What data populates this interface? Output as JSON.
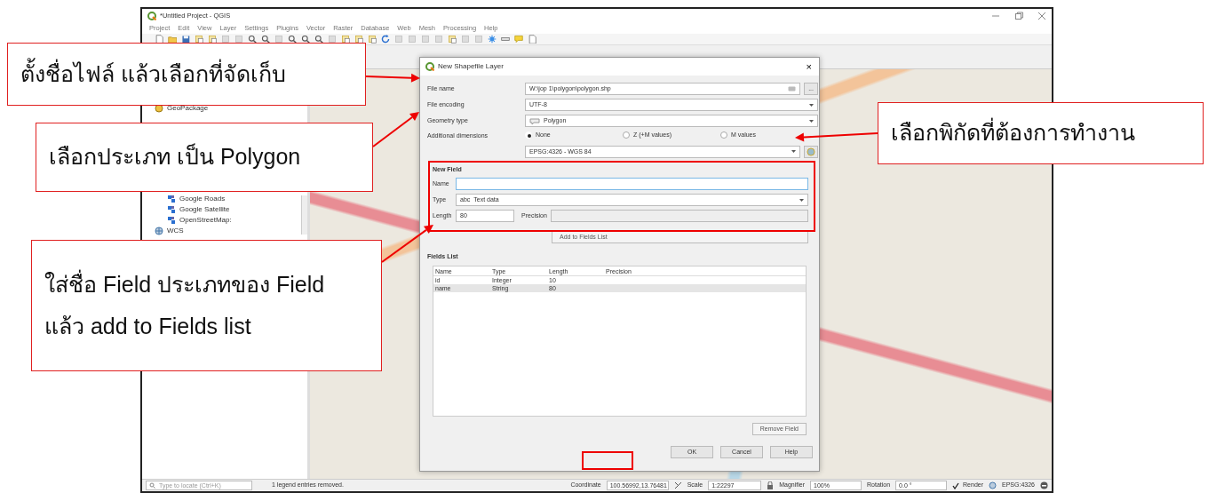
{
  "window": {
    "title": "*Untitled Project - QGIS"
  },
  "menu": [
    "Project",
    "Edit",
    "View",
    "Layer",
    "Settings",
    "Plugins",
    "Vector",
    "Raster",
    "Database",
    "Web",
    "Mesh",
    "Processing",
    "Help"
  ],
  "browser": {
    "items": [
      {
        "label": "GeoPackage",
        "kind": "db"
      },
      {
        "label": "Google Roads",
        "kind": "tile"
      },
      {
        "label": "Google Satellite",
        "kind": "tile"
      },
      {
        "label": "OpenStreetMap:",
        "kind": "tile"
      },
      {
        "label": "WCS",
        "kind": "globe"
      }
    ]
  },
  "dialog": {
    "title": "New Shapefile Layer",
    "close": "×",
    "file_name": {
      "label": "File name",
      "value": "W:\\jop 1\\polygon\\polygon.shp",
      "browse": "..."
    },
    "encoding": {
      "label": "File encoding",
      "value": "UTF-8"
    },
    "geometry": {
      "label": "Geometry type",
      "value": "Polygon"
    },
    "dimensions": {
      "label": "Additional dimensions",
      "options": [
        {
          "label": "None",
          "selected": true
        },
        {
          "label": "Z (+M values)",
          "selected": false
        },
        {
          "label": "M values",
          "selected": false
        }
      ]
    },
    "crs": {
      "value": "EPSG:4326 - WGS 84"
    },
    "new_field": {
      "title": "New Field",
      "name_label": "Name",
      "type_label": "Type",
      "type_icon": "abc",
      "type_value": "Text data",
      "length_label": "Length",
      "length_value": "80",
      "precision_label": "Precision",
      "add_button": "Add to Fields List",
      "add_disabled": true
    },
    "fields_list": {
      "title": "Fields List",
      "columns": [
        "Name",
        "Type",
        "Length",
        "Precision"
      ],
      "rows": [
        {
          "cells": [
            "id",
            "Integer",
            "10",
            ""
          ],
          "selected": false
        },
        {
          "cells": [
            "name",
            "String",
            "80",
            ""
          ],
          "selected": true
        }
      ],
      "remove_button": "Remove Field",
      "remove_disabled": true
    },
    "buttons": [
      "OK",
      "Cancel",
      "Help"
    ]
  },
  "status_bar": {
    "search_placeholder": "Type to locate (Ctrl+K)",
    "message": "1 legend entries removed.",
    "coordinate_label": "Coordinate",
    "coordinate": "100.56992,13.76481",
    "scale_label": "Scale",
    "scale": "1:22297",
    "magnifier_label": "Magnifier",
    "magnifier": "100%",
    "rotation_label": "Rotation",
    "rotation": "0.0 °",
    "render": {
      "label": "Render",
      "checked": true
    },
    "crs": "EPSG:4326"
  },
  "callouts": [
    {
      "lines": [
        "ตั้งชื่อไฟล์ แล้วเลือกที่จัดเก็บ"
      ]
    },
    {
      "lines": [
        "เลือกประเภท เป็น Polygon"
      ]
    },
    {
      "lines": [
        "เลือกพิกัดที่ต้องการทำงาน"
      ]
    },
    {
      "lines": [
        "ใส่ชื่อ Field ประเภทของ Field",
        "แล้ว add to Fields list"
      ]
    }
  ]
}
